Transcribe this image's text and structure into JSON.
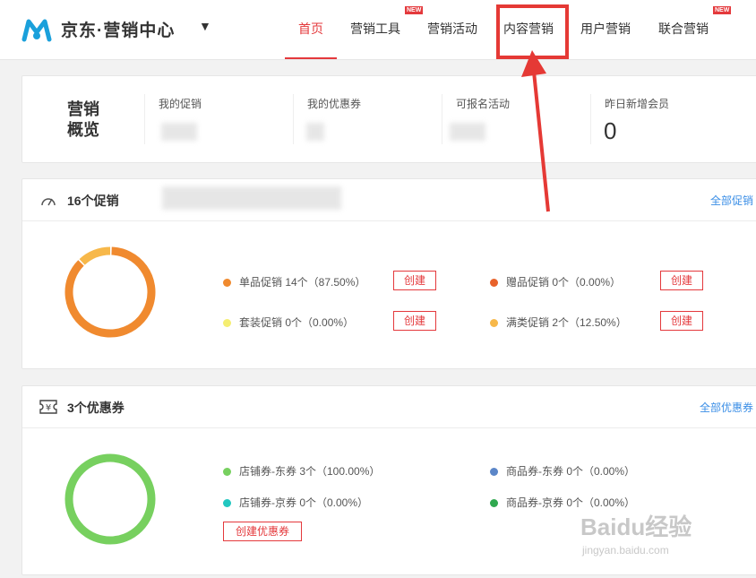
{
  "brand": {
    "name": "京东·营销中心",
    "caret": "▼",
    "logo_color": "#1aa0db"
  },
  "nav": {
    "items": [
      {
        "label": "首页",
        "active": true,
        "new": false
      },
      {
        "label": "营销工具",
        "active": false,
        "new": true
      },
      {
        "label": "营销活动",
        "active": false,
        "new": false
      },
      {
        "label": "内容营销",
        "active": false,
        "new": false
      },
      {
        "label": "用户营销",
        "active": false,
        "new": false
      },
      {
        "label": "联合营销",
        "active": false,
        "new": true
      }
    ],
    "new_tag": "NEW"
  },
  "overview": {
    "title": "营销概览",
    "stats": [
      {
        "label": "我的促销",
        "value": ""
      },
      {
        "label": "我的优惠券",
        "value": ""
      },
      {
        "label": "可报名活动",
        "value": ""
      },
      {
        "label": "昨日新增会员",
        "value": "0"
      }
    ]
  },
  "promotions": {
    "title": "16个促销",
    "link": "全部促销",
    "items": [
      {
        "name": "单品促销",
        "text": "单品促销 14个（87.50%）",
        "color": "#f08a2f",
        "button": "创建"
      },
      {
        "name": "赠品促销",
        "text": "赠品促销 0个（0.00%）",
        "color": "#e8622a",
        "button": "创建"
      },
      {
        "name": "套装促销",
        "text": "套装促销 0个（0.00%）",
        "color": "#f5ee72",
        "button": "创建"
      },
      {
        "name": "满类促销",
        "text": "满类促销 2个（12.50%）",
        "color": "#f7b84a",
        "button": "创建"
      }
    ],
    "donut": [
      {
        "name": "单品促销",
        "value": 87.5,
        "color": "#f08a2f"
      },
      {
        "name": "满类促销",
        "value": 12.5,
        "color": "#f7b84a"
      }
    ]
  },
  "coupons": {
    "title": "3个优惠券",
    "link": "全部优惠券",
    "items": [
      {
        "text": "店铺券-东券 3个（100.00%）",
        "color": "#77d05f"
      },
      {
        "text": "商品券-东券 0个（0.00%）",
        "color": "#5b86c8"
      },
      {
        "text": "店铺券-京券 0个（0.00%）",
        "color": "#22c7c0"
      },
      {
        "text": "商品券-京券 0个（0.00%）",
        "color": "#2fa84f"
      }
    ],
    "create_button": "创建优惠券",
    "donut": [
      {
        "name": "店铺券-东券",
        "value": 100,
        "color": "#77d05f"
      }
    ]
  },
  "watermark": {
    "text": "Baidu经验",
    "sub": "jingyan.baidu.com"
  }
}
